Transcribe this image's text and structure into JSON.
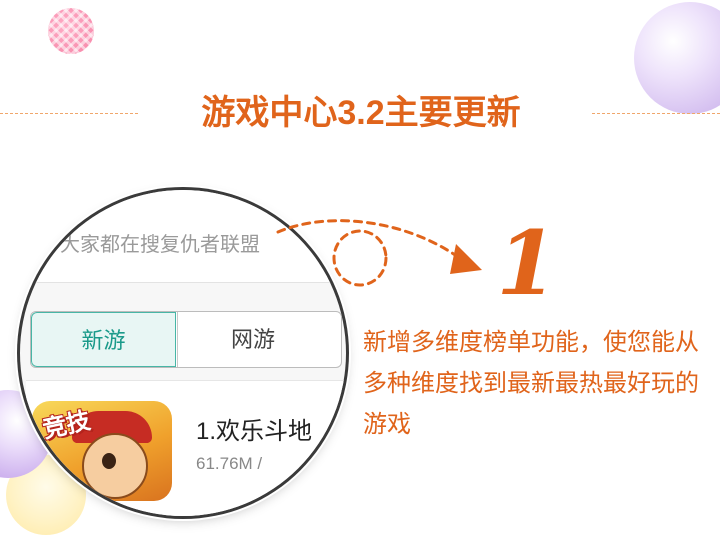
{
  "heading": {
    "title": "游戏中心3.2主要更新"
  },
  "magnifier": {
    "search_placeholder": "大家都在搜复仇者联盟",
    "tabs": [
      {
        "label": "新游",
        "selected": true
      },
      {
        "label": "网游",
        "selected": false
      }
    ],
    "list": [
      {
        "name": "1.欢乐斗地",
        "meta": "61.76M /",
        "icon": "game-icon",
        "icon_badge": "竞技"
      }
    ]
  },
  "feature": {
    "number": "1",
    "description": "新增多维度榜单功能，使您能从多种维度找到最新最热最好玩的游戏"
  },
  "colors": {
    "accent": "#e0641b",
    "tab_selected_text": "#1a9a8a",
    "tab_selected_border": "#47b6a6"
  }
}
